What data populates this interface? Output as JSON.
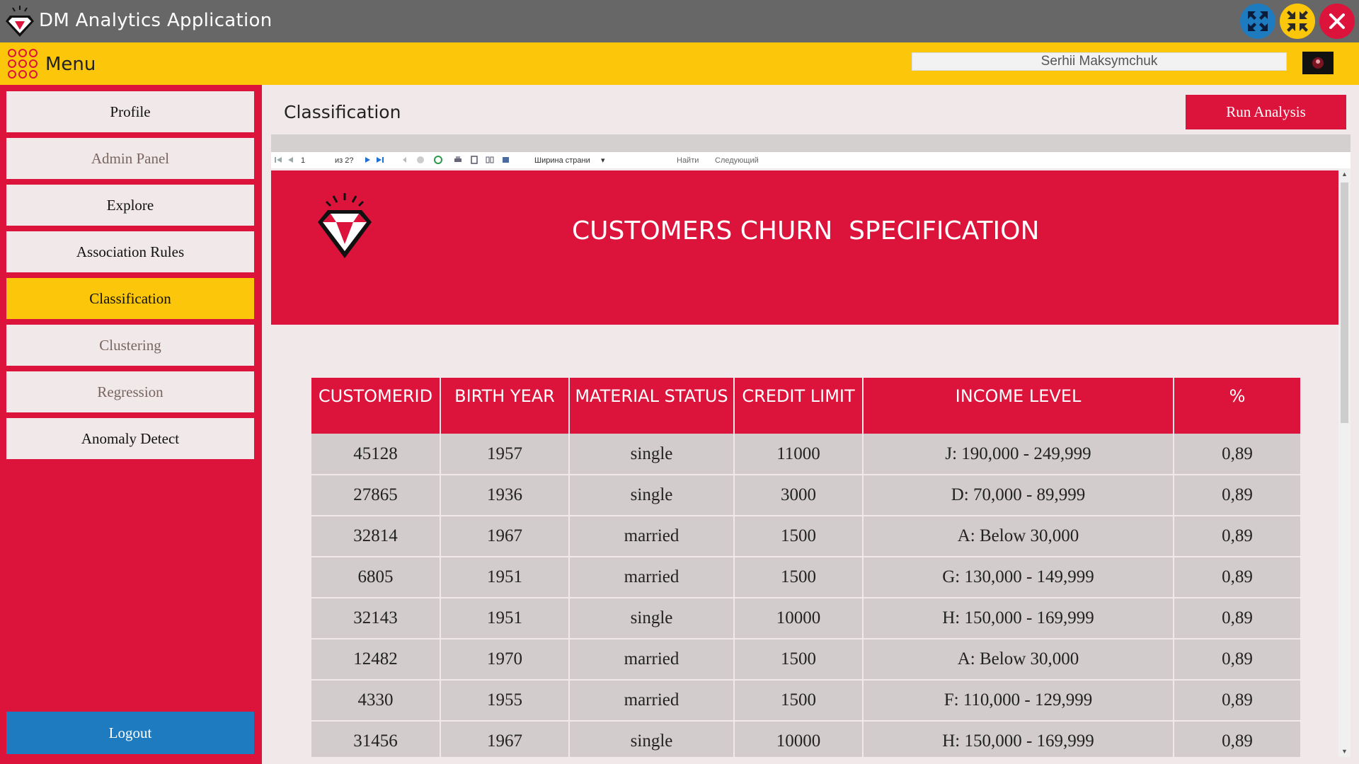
{
  "app": {
    "title": "DM Analytics Application"
  },
  "window_controls": {
    "maximize_icon": "maximize-arrows-icon",
    "minimize_icon": "minimize-arrows-icon",
    "close_icon": "close-x-icon"
  },
  "menu": {
    "label": "Menu",
    "icon": "grid-dots-icon"
  },
  "user": {
    "name": "Serhii Maksymchuk"
  },
  "sidebar": {
    "items": [
      {
        "label": "Profile",
        "state": "normal"
      },
      {
        "label": "Admin Panel",
        "state": "muted"
      },
      {
        "label": "Explore",
        "state": "normal"
      },
      {
        "label": "Association Rules",
        "state": "normal"
      },
      {
        "label": "Classification",
        "state": "active"
      },
      {
        "label": "Clustering",
        "state": "muted"
      },
      {
        "label": "Regression",
        "state": "muted"
      },
      {
        "label": "Anomaly Detect",
        "state": "normal"
      }
    ],
    "logout": "Logout"
  },
  "page": {
    "title": "Classification",
    "run_button": "Run Analysis"
  },
  "report_toolbar": {
    "page_number": "1",
    "page_of": "из 2?",
    "zoom": "Ширина страни",
    "find": "Найти",
    "next": "Следующий"
  },
  "report": {
    "title": "CUSTOMERS CHURN  SPECIFICATION",
    "columns": [
      "CUSTOMERID",
      "BIRTH YEAR",
      "MATERIAL STATUS",
      "CREDIT LIMIT",
      "INCOME LEVEL",
      "%"
    ],
    "rows": [
      [
        "45128",
        "1957",
        "single",
        "11000",
        "J: 190,000 - 249,999",
        "0,89"
      ],
      [
        "27865",
        "1936",
        "single",
        "3000",
        "D: 70,000 - 89,999",
        "0,89"
      ],
      [
        "32814",
        "1967",
        "married",
        "1500",
        "A: Below 30,000",
        "0,89"
      ],
      [
        "6805",
        "1951",
        "married",
        "1500",
        "G: 130,000 - 149,999",
        "0,89"
      ],
      [
        "32143",
        "1951",
        "single",
        "10000",
        "H: 150,000 - 169,999",
        "0,89"
      ],
      [
        "12482",
        "1970",
        "married",
        "1500",
        "A: Below 30,000",
        "0,89"
      ],
      [
        "4330",
        "1955",
        "married",
        "1500",
        "F: 110,000 - 129,999",
        "0,89"
      ],
      [
        "31456",
        "1967",
        "single",
        "10000",
        "H: 150,000 - 169,999",
        "0,89"
      ]
    ]
  },
  "colors": {
    "crimson": "#dc143c",
    "yellow": "#fcc70a",
    "blue": "#1f7bc0",
    "titlebar": "#676767",
    "background": "#f0e8e9"
  }
}
